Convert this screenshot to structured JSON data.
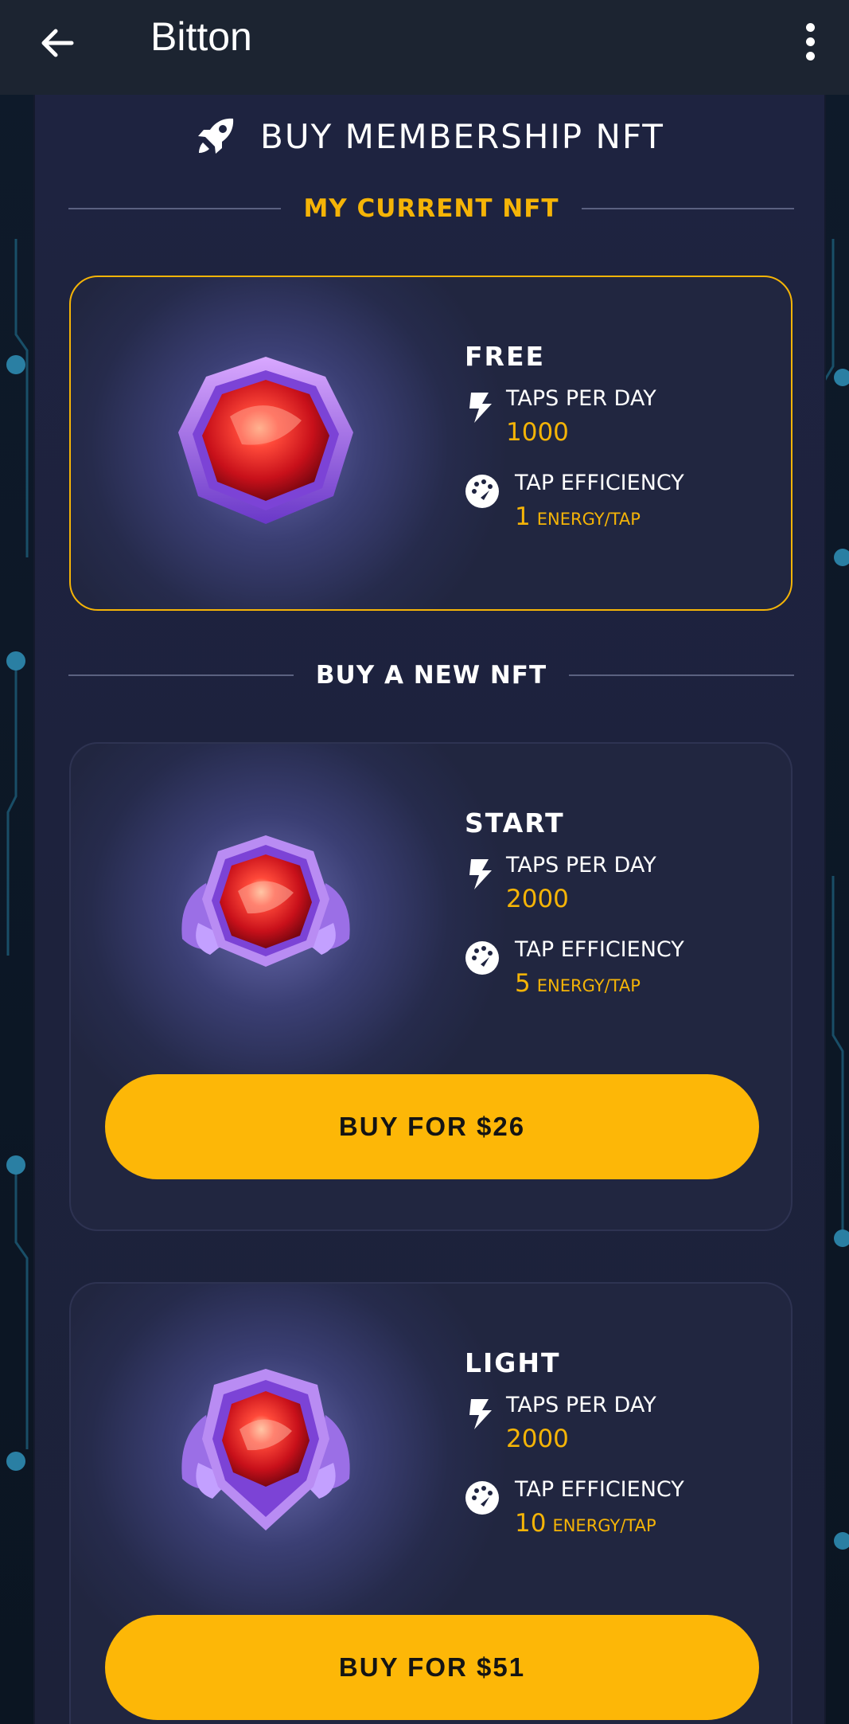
{
  "app_bar": {
    "title": "Bitton",
    "back_icon": "arrow-left-icon",
    "menu_icon": "more-vert-icon"
  },
  "heading": {
    "icon": "rocket-icon",
    "text": "BUY MEMBERSHIP NFT"
  },
  "current_section": {
    "label": "MY CURRENT NFT",
    "card": {
      "tier": "FREE",
      "taps_label": "TAPS PER DAY",
      "taps_value": "1000",
      "efficiency_label": "TAP EFFICIENCY",
      "efficiency_value": "1",
      "efficiency_unit": "ENERGY/TAP"
    }
  },
  "buy_section": {
    "label": "BUY A NEW NFT",
    "cards": [
      {
        "tier": "START",
        "taps_label": "TAPS PER DAY",
        "taps_value": "2000",
        "efficiency_label": "TAP EFFICIENCY",
        "efficiency_value": "5",
        "efficiency_unit": "ENERGY/TAP",
        "button_label": "BUY FOR $26"
      },
      {
        "tier": "LIGHT",
        "taps_label": "TAPS PER DAY",
        "taps_value": "2000",
        "efficiency_label": "TAP EFFICIENCY",
        "efficiency_value": "10",
        "efficiency_unit": "ENERGY/TAP",
        "button_label": "BUY FOR $51"
      }
    ]
  },
  "colors": {
    "accent": "#fdb707",
    "panel": "#1e2340",
    "appbar": "#1c2431"
  }
}
